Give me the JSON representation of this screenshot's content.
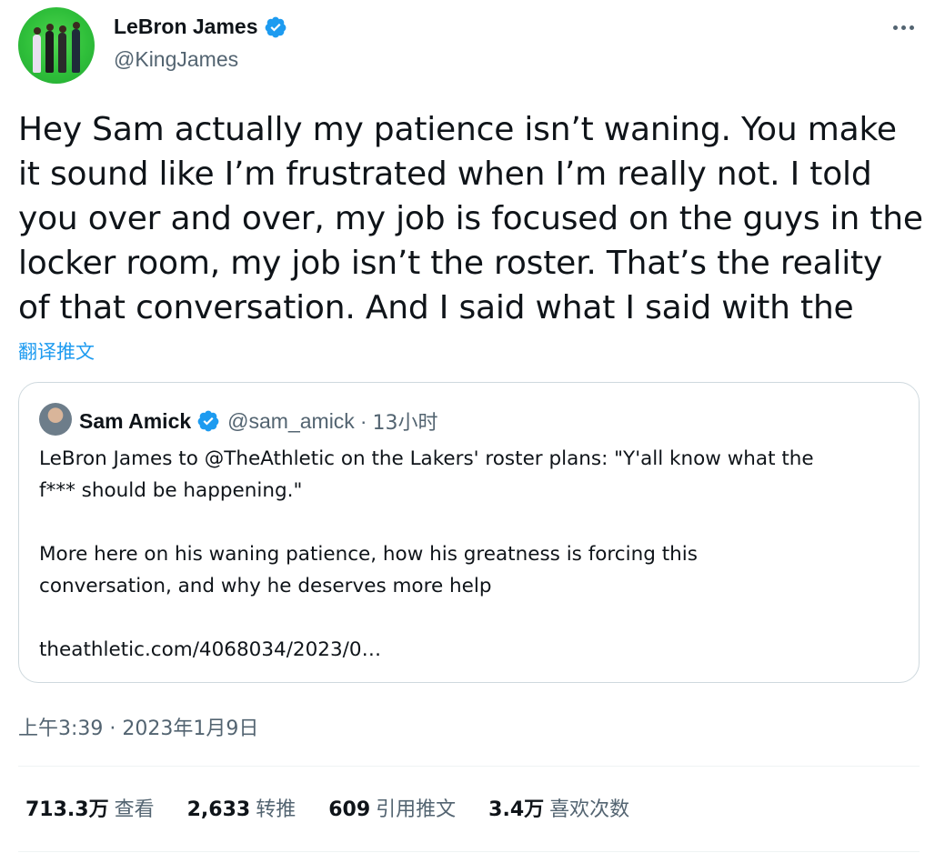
{
  "author": {
    "name": "LeBron James",
    "handle": "@KingJames",
    "verified": true
  },
  "tweet": {
    "lines": [
      "Hey Sam actually my patience isn’t waning. You make",
      "it sound like I’m frustrated when I’m really not. I told",
      "you over and over, my job is focused on the guys in the",
      "locker room, my job isn’t the roster. That’s the reality",
      "of that conversation. And I said what I said with the"
    ],
    "translate_label": "翻译推文"
  },
  "quote": {
    "name": "Sam Amick",
    "handle": "@sam_amick",
    "separator": "·",
    "time": "13小时",
    "lines": [
      "LeBron James to @TheAthletic on the Lakers' roster plans: \"Y'all know what the",
      "f*** should be happening.\"",
      "",
      "More here on his waning patience, how his greatness is forcing this",
      "conversation, and why he deserves more help",
      "",
      "theathletic.com/4068034/2023/0…"
    ]
  },
  "timestamp": {
    "time": "上午3:39",
    "separator": "·",
    "date": "2023年1月9日"
  },
  "stats": [
    {
      "value": "713.3万",
      "label": "查看"
    },
    {
      "value": "2,633",
      "label": "转推"
    },
    {
      "value": "609",
      "label": "引用推文"
    },
    {
      "value": "3.4万",
      "label": "喜欢次数"
    }
  ],
  "colors": {
    "accent": "#1d9bf0",
    "text": "#0f1419",
    "secondary": "#536471",
    "border": "#cfd9de"
  },
  "icons": {
    "verified": "verified-badge-icon",
    "more": "more-horizontal-icon"
  }
}
